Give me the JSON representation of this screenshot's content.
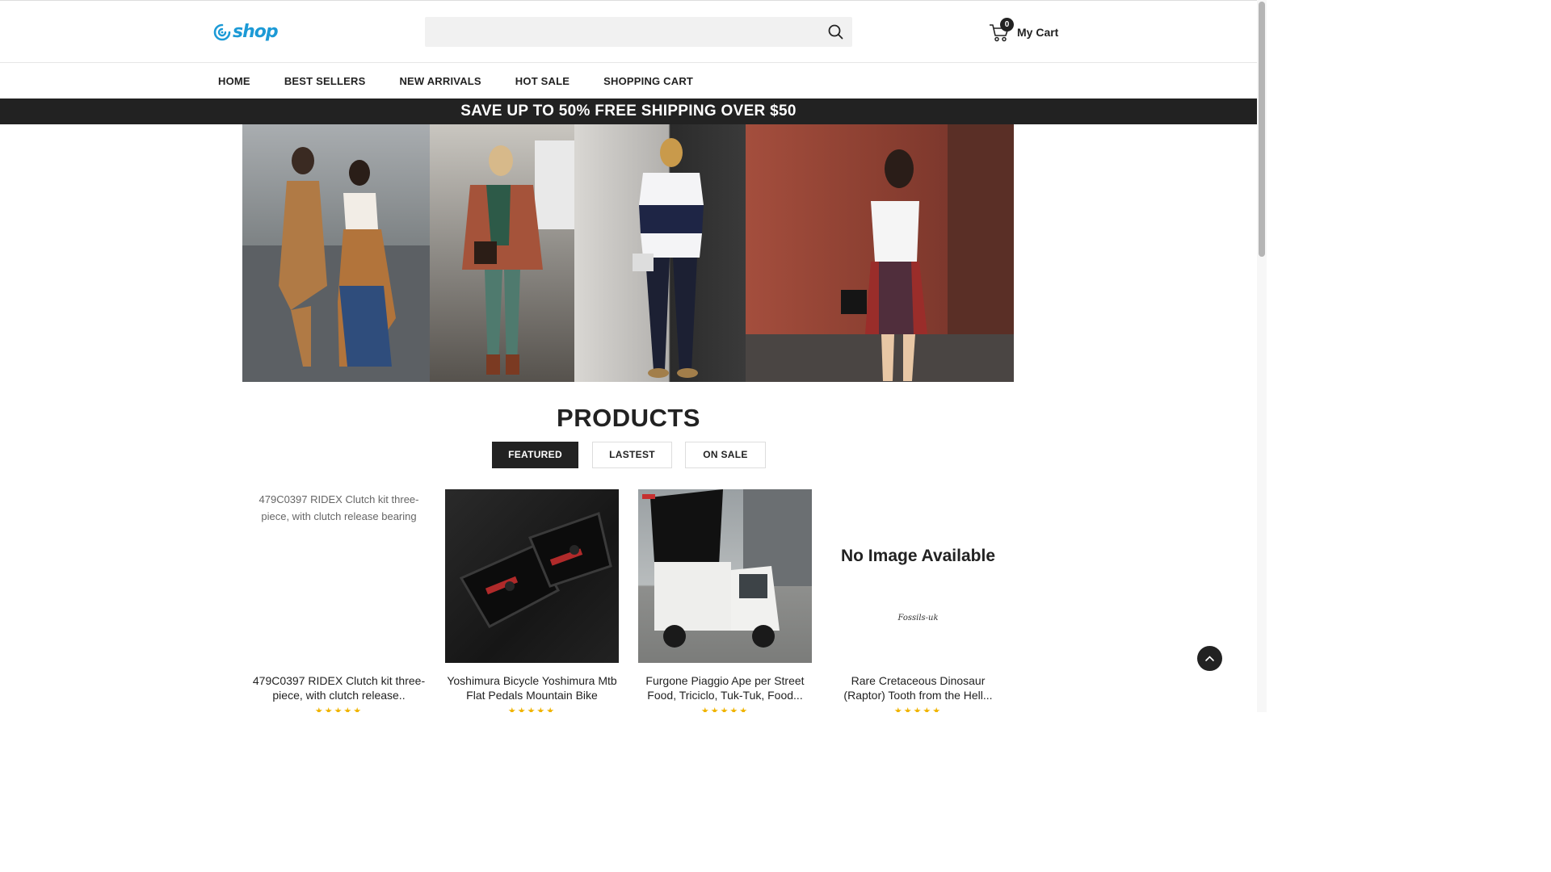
{
  "header": {
    "logo_text": "shop",
    "search_placeholder": "",
    "cart_count": "0",
    "cart_label": "My Cart"
  },
  "nav": {
    "items": [
      "HOME",
      "BEST SELLERS",
      "NEW ARRIVALS",
      "HOT SALE",
      "SHOPPING CART"
    ]
  },
  "promo": {
    "text": "SAVE UP TO 50% FREE SHIPPING OVER $50"
  },
  "products": {
    "title": "PRODUCTS",
    "tabs": [
      {
        "label": "FEATURED",
        "active": true
      },
      {
        "label": "LASTEST",
        "active": false
      },
      {
        "label": "ON SALE",
        "active": false
      }
    ],
    "items": [
      {
        "image_alt": "479C0397 RIDEX Clutch kit three-piece, with clutch release bearing",
        "name": "479C0397 RIDEX Clutch kit three-piece, with clutch release..",
        "rating": 5
      },
      {
        "image_alt": "",
        "name": "Yoshimura Bicycle Yoshimura Mtb Flat Pedals Mountain Bike",
        "rating": 5
      },
      {
        "image_alt": "",
        "name": "Furgone Piaggio Ape per Street Food, Triciclo, Tuk-Tuk, Food...",
        "rating": 5
      },
      {
        "image_alt": "",
        "no_image_text": "No Image Available",
        "name": "Rare Cretaceous Dinosaur (Raptor) Tooth from the Hell...",
        "rating": 5
      }
    ]
  },
  "colors": {
    "brand": "#1c9ad6",
    "dark": "#222222",
    "star": "#f0b400"
  }
}
